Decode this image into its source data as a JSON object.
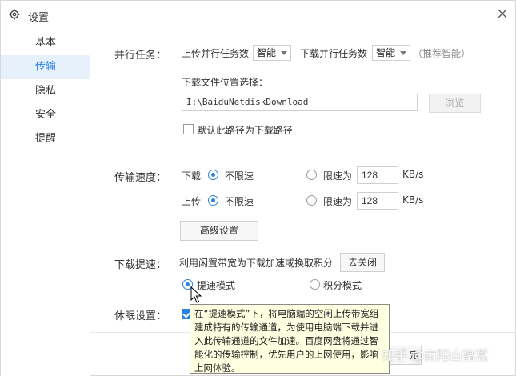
{
  "window": {
    "title": "设置",
    "icon": "gear-icon"
  },
  "sidebar": {
    "items": [
      {
        "label": "基本",
        "active": false
      },
      {
        "label": "传输",
        "active": true
      },
      {
        "label": "隐私",
        "active": false
      },
      {
        "label": "安全",
        "active": false
      },
      {
        "label": "提醒",
        "active": false
      }
    ]
  },
  "tasks": {
    "section_label": "并行任务：",
    "upload_label": "上传并行任务数",
    "upload_value": "智能",
    "download_label": "下载并行任务数",
    "download_value": "智能",
    "hint": "（推荐智能）"
  },
  "location": {
    "label": "下载文件位置选择：",
    "path": "I:\\BaiduNetdiskDownload",
    "browse_label": "浏览",
    "default_checkbox_label": "默认此路径为下载路径",
    "default_checked": false
  },
  "speed": {
    "section_label": "传输速度：",
    "download": {
      "label": "下载",
      "unlimited_label": "不限速",
      "limited_label": "限速为",
      "limit_value": "128",
      "unit": "KB/s",
      "unlimited_selected": true
    },
    "upload": {
      "label": "上传",
      "unlimited_label": "不限速",
      "limited_label": "限速为",
      "limit_value": "128",
      "unit": "KB/s",
      "unlimited_selected": true
    },
    "advanced_button_label": "高级设置"
  },
  "boost": {
    "section_label": "下载提速：",
    "description": "利用闲置带宽为下载加速或换取积分",
    "close_button_label": "去关闭",
    "mode_speed_label": "提速模式",
    "mode_points_label": "积分模式",
    "speed_mode_selected": true
  },
  "sleep": {
    "section_label": "休眠设置：",
    "checked": true
  },
  "tooltip": {
    "text": "在“提速模式”下，将电脑端的空闲上传带宽组建成特有的传输通道，为使用电脑端下载并进入此传输通道的文件加速。百度网盘将通过智能化的传输控制，优先用户的上网使用，影响上网体验。"
  },
  "footer": {
    "ok_button_partial": "定"
  },
  "watermark": {
    "text": "知乎 @南阳山猪蒿"
  },
  "colors": {
    "accent": "#2a82e4",
    "active_bg": "#e6f1fb",
    "tooltip_bg": "#ffffe1"
  }
}
